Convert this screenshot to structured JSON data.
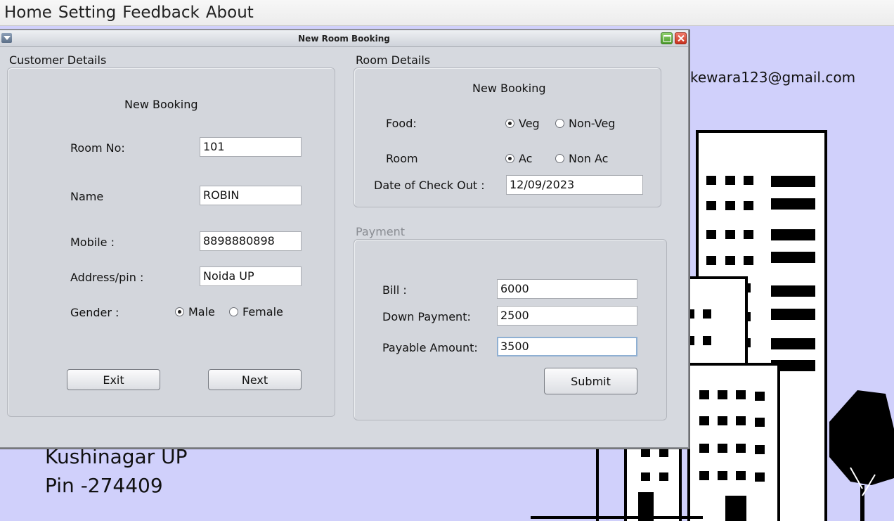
{
  "menubar": {
    "items": [
      "Home",
      "Setting",
      "Feedback",
      "About"
    ]
  },
  "background": {
    "email": "kewara123@gmail.com",
    "address_line1": "Kushinagar UP",
    "address_line2": "Pin -274409"
  },
  "window": {
    "title": "New Room Booking"
  },
  "customer": {
    "section_title": "Customer Details",
    "heading": "New Booking",
    "room_no_label": "Room No:",
    "room_no_value": "101",
    "name_label": "Name",
    "name_value": "ROBIN",
    "mobile_label": "Mobile :",
    "mobile_value": "8898880898",
    "address_label": "Address/pin :",
    "address_value": "Noida UP",
    "gender_label": "Gender :",
    "gender_male": "Male",
    "gender_female": "Female",
    "gender_selected": "Male",
    "exit_label": "Exit",
    "next_label": "Next"
  },
  "room": {
    "section_title": "Room Details",
    "heading": "New Booking",
    "food_label": "Food:",
    "food_veg": "Veg",
    "food_nonveg": "Non-Veg",
    "food_selected": "Veg",
    "room_label": "Room",
    "room_ac": "Ac",
    "room_nonac": "Non Ac",
    "room_selected": "Ac",
    "checkout_label": "Date of Check Out :",
    "checkout_value": "12/09/2023"
  },
  "payment": {
    "section_title": "Payment",
    "bill_label": "Bill :",
    "bill_value": "6000",
    "down_label": "Down Payment:",
    "down_value": "2500",
    "payable_label": "Payable Amount:",
    "payable_value": "3500",
    "submit_label": "Submit"
  },
  "colors": {
    "desktop": "#d0d0fb",
    "frame": "#d6d9df"
  }
}
